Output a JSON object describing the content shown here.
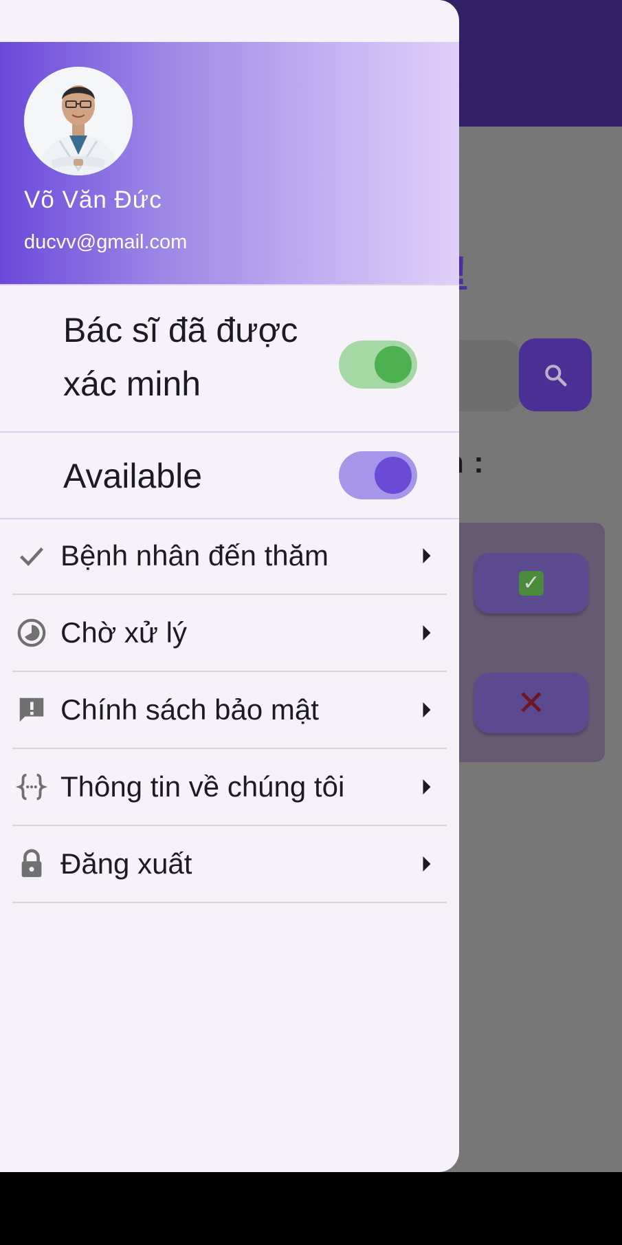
{
  "background_app": {
    "heading_fragment": "!",
    "label_fragment": "n :",
    "accept_icon": "check-box-icon",
    "reject_icon": "cross-icon",
    "check_glyph": "✓",
    "cross_glyph": "✕"
  },
  "drawer": {
    "user": {
      "name": "Võ Văn Đức",
      "email": "ducvv@gmail.com"
    },
    "toggles": {
      "verified": {
        "label": "Bác sĩ đã được xác minh",
        "on": true,
        "color": "#4caf50"
      },
      "available": {
        "label": "Available",
        "on": true,
        "color": "#6b4ad6"
      }
    },
    "menu": [
      {
        "label": "Bệnh nhân đến thăm",
        "icon": "check-icon"
      },
      {
        "label": "Chờ xử lý",
        "icon": "pie-clock-icon"
      },
      {
        "label": "Chính sách bảo mật",
        "icon": "feedback-alert-icon"
      },
      {
        "label": "Thông tin về chúng tôi",
        "icon": "code-braces-icon"
      },
      {
        "label": "Đăng xuất",
        "icon": "lock-icon"
      }
    ]
  },
  "colors": {
    "brand": "#312066",
    "header_gradient_start": "#6b48da",
    "header_gradient_end": "#e1cff8",
    "drawer_bg": "#f7f2f9"
  }
}
